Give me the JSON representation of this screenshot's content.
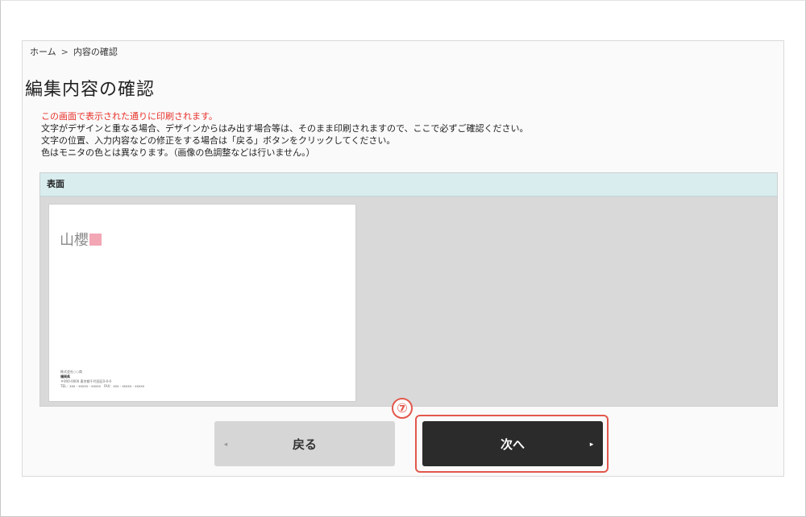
{
  "breadcrumb": {
    "home": "ホーム",
    "separator": ">",
    "current": "内容の確認"
  },
  "page_title": "編集内容の確認",
  "notices": {
    "warning": "この画面で表示された通りに印刷されます。",
    "line1": "文字がデザインと重なる場合、デザインからはみ出す場合等は、そのまま印刷されますので、ここで必ずご確認ください。",
    "line2": "文字の位置、入力内容などの修正をする場合は「戻る」ボタンをクリックしてください。",
    "line3": "色はモニタの色とは異なります。（画像の色調整などは行いません。）"
  },
  "preview": {
    "header": "表面",
    "card": {
      "name": "山櫻",
      "company": "株式会社○○商",
      "person": "福岡県",
      "address": "〒000-0000 東京都千代田区0-0-0",
      "contact": "TEL：xxx - xxxxx - xxxxx　FAX：xxx - xxxxx - xxxxx"
    }
  },
  "step_badge": "⑦",
  "buttons": {
    "back_label": "戻る",
    "next_label": "次へ",
    "back_arrow": "◂",
    "next_arrow": "▸"
  },
  "colors": {
    "warning_text": "#e8322b",
    "panel_header_bg": "#d9edef",
    "next_button_bg": "#2b2b2b",
    "highlight_border": "#e2584c",
    "card_accent": "#f3a6b4"
  }
}
